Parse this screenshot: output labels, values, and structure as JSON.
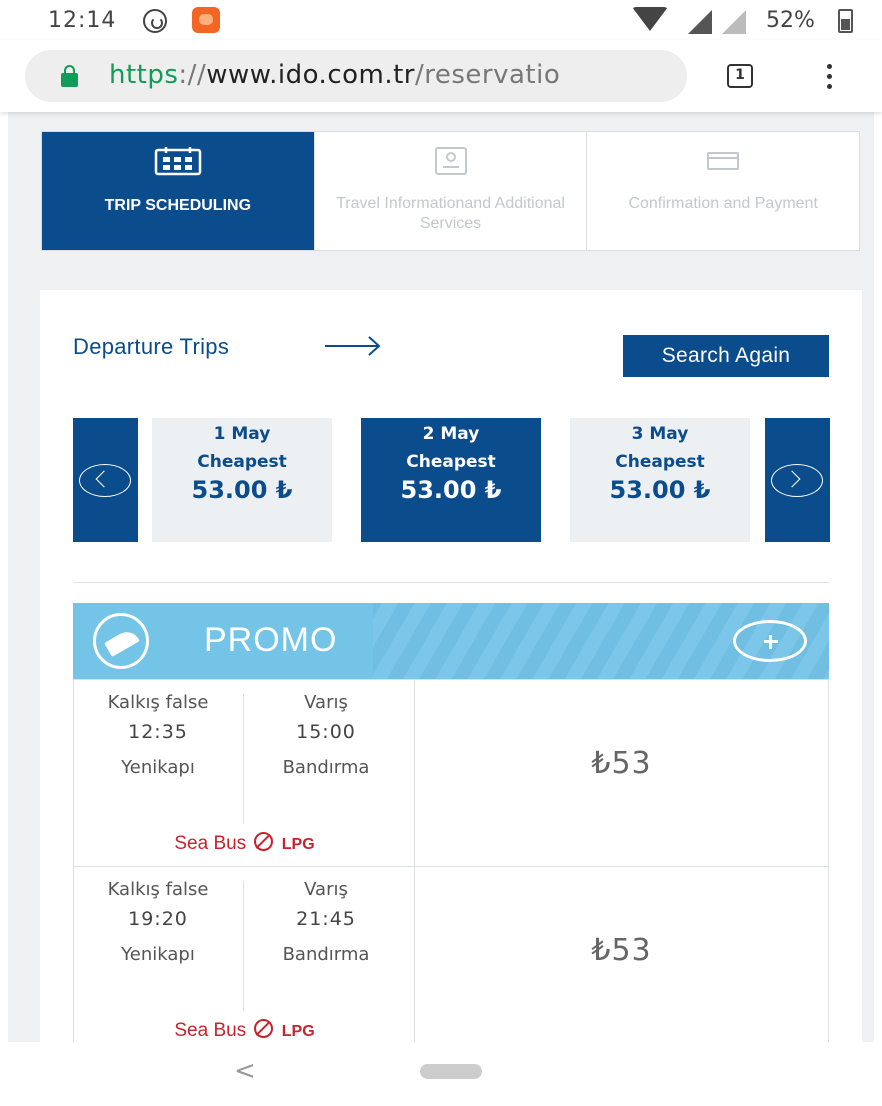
{
  "status_bar": {
    "time": "12:14",
    "battery": "52%"
  },
  "browser": {
    "url_scheme": "https",
    "url_sep": "://",
    "url_host": "www.ido.com.tr",
    "url_path": "/reservatio",
    "tabs_count": "1"
  },
  "steps": [
    {
      "label": "TRIP SCHEDULING",
      "active": true
    },
    {
      "label": "Travel Informationand Additional Services",
      "active": false
    },
    {
      "label": "Confirmation and Payment",
      "active": false
    }
  ],
  "departure": {
    "title": "Departure Trips",
    "search_again": "Search Again"
  },
  "dates": [
    {
      "date": "1 May",
      "label": "Cheapest",
      "price": "53.00 ₺",
      "active": false
    },
    {
      "date": "2 May",
      "label": "Cheapest",
      "price": "53.00 ₺",
      "active": true
    },
    {
      "date": "3 May",
      "label": "Cheapest",
      "price": "53.00 ₺",
      "active": false
    }
  ],
  "promo": {
    "title": "PROMO"
  },
  "trips": [
    {
      "dep_label": "Kalkış false",
      "dep_time": "12:35",
      "dep_port": "Yenikapı",
      "arr_label": "Varış",
      "arr_time": "15:00",
      "arr_port": "Bandırma",
      "vessel": "Sea Bus",
      "fuel": "LPG",
      "price": "₺53"
    },
    {
      "dep_label": "Kalkış false",
      "dep_time": "19:20",
      "dep_port": "Yenikapı",
      "arr_label": "Varış",
      "arr_time": "21:45",
      "arr_port": "Bandırma",
      "vessel": "Sea Bus",
      "fuel": "LPG",
      "price": "₺53"
    }
  ],
  "colors": {
    "primary": "#0b4c8c",
    "promo": "#74c4e8",
    "accent_red": "#c8232c",
    "secure_green": "#0f9d58"
  },
  "icons": [
    "whatsapp-icon",
    "app-notification-icon",
    "wifi-icon",
    "signal-icon",
    "battery-icon",
    "lock-icon",
    "calendar-icon",
    "passenger-card-icon",
    "credit-card-icon",
    "arrow-right-icon",
    "chevron-left-icon",
    "chevron-right-icon",
    "promo-logo-icon",
    "plus-icon",
    "no-entry-icon",
    "back-icon"
  ]
}
